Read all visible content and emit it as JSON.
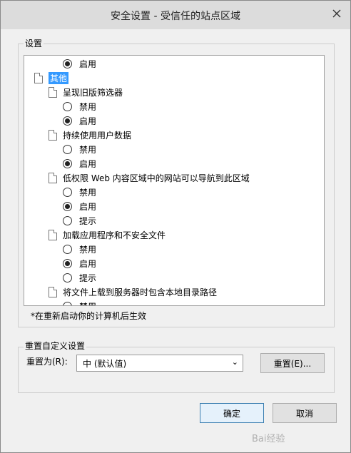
{
  "window": {
    "title": "安全设置 - 受信任的站点区域"
  },
  "settings": {
    "group_label": "设置",
    "items": [
      {
        "type": "radio",
        "label": "启用",
        "checked": true,
        "indent": 2
      },
      {
        "type": "category",
        "label": "其他",
        "indent": 0,
        "selected": true
      },
      {
        "type": "setting",
        "label": "呈现旧版筛选器",
        "indent": 1
      },
      {
        "type": "radio",
        "label": "禁用",
        "checked": false,
        "indent": 2
      },
      {
        "type": "radio",
        "label": "启用",
        "checked": true,
        "indent": 2
      },
      {
        "type": "setting",
        "label": "持续使用用户数据",
        "indent": 1
      },
      {
        "type": "radio",
        "label": "禁用",
        "checked": false,
        "indent": 2
      },
      {
        "type": "radio",
        "label": "启用",
        "checked": true,
        "indent": 2
      },
      {
        "type": "setting",
        "label": "低权限 Web 内容区域中的网站可以导航到此区域",
        "indent": 1
      },
      {
        "type": "radio",
        "label": "禁用",
        "checked": false,
        "indent": 2
      },
      {
        "type": "radio",
        "label": "启用",
        "checked": true,
        "indent": 2
      },
      {
        "type": "radio",
        "label": "提示",
        "checked": false,
        "indent": 2
      },
      {
        "type": "setting",
        "label": "加载应用程序和不安全文件",
        "indent": 1
      },
      {
        "type": "radio",
        "label": "禁用",
        "checked": false,
        "indent": 2
      },
      {
        "type": "radio",
        "label": "启用",
        "checked": true,
        "indent": 2
      },
      {
        "type": "radio",
        "label": "提示",
        "checked": false,
        "indent": 2
      },
      {
        "type": "setting",
        "label": "将文件上载到服务器时包含本地目录路径",
        "indent": 1
      },
      {
        "type": "radio",
        "label": "禁用",
        "checked": false,
        "indent": 2
      }
    ],
    "note": "*在重新启动你的计算机后生效"
  },
  "reset": {
    "group_label": "重置自定义设置",
    "reset_to_label": "重置为(R):",
    "selected_option": "中 (默认值)",
    "reset_button": "重置(E)..."
  },
  "buttons": {
    "ok": "确定",
    "cancel": "取消"
  },
  "watermark": "Bai经验"
}
